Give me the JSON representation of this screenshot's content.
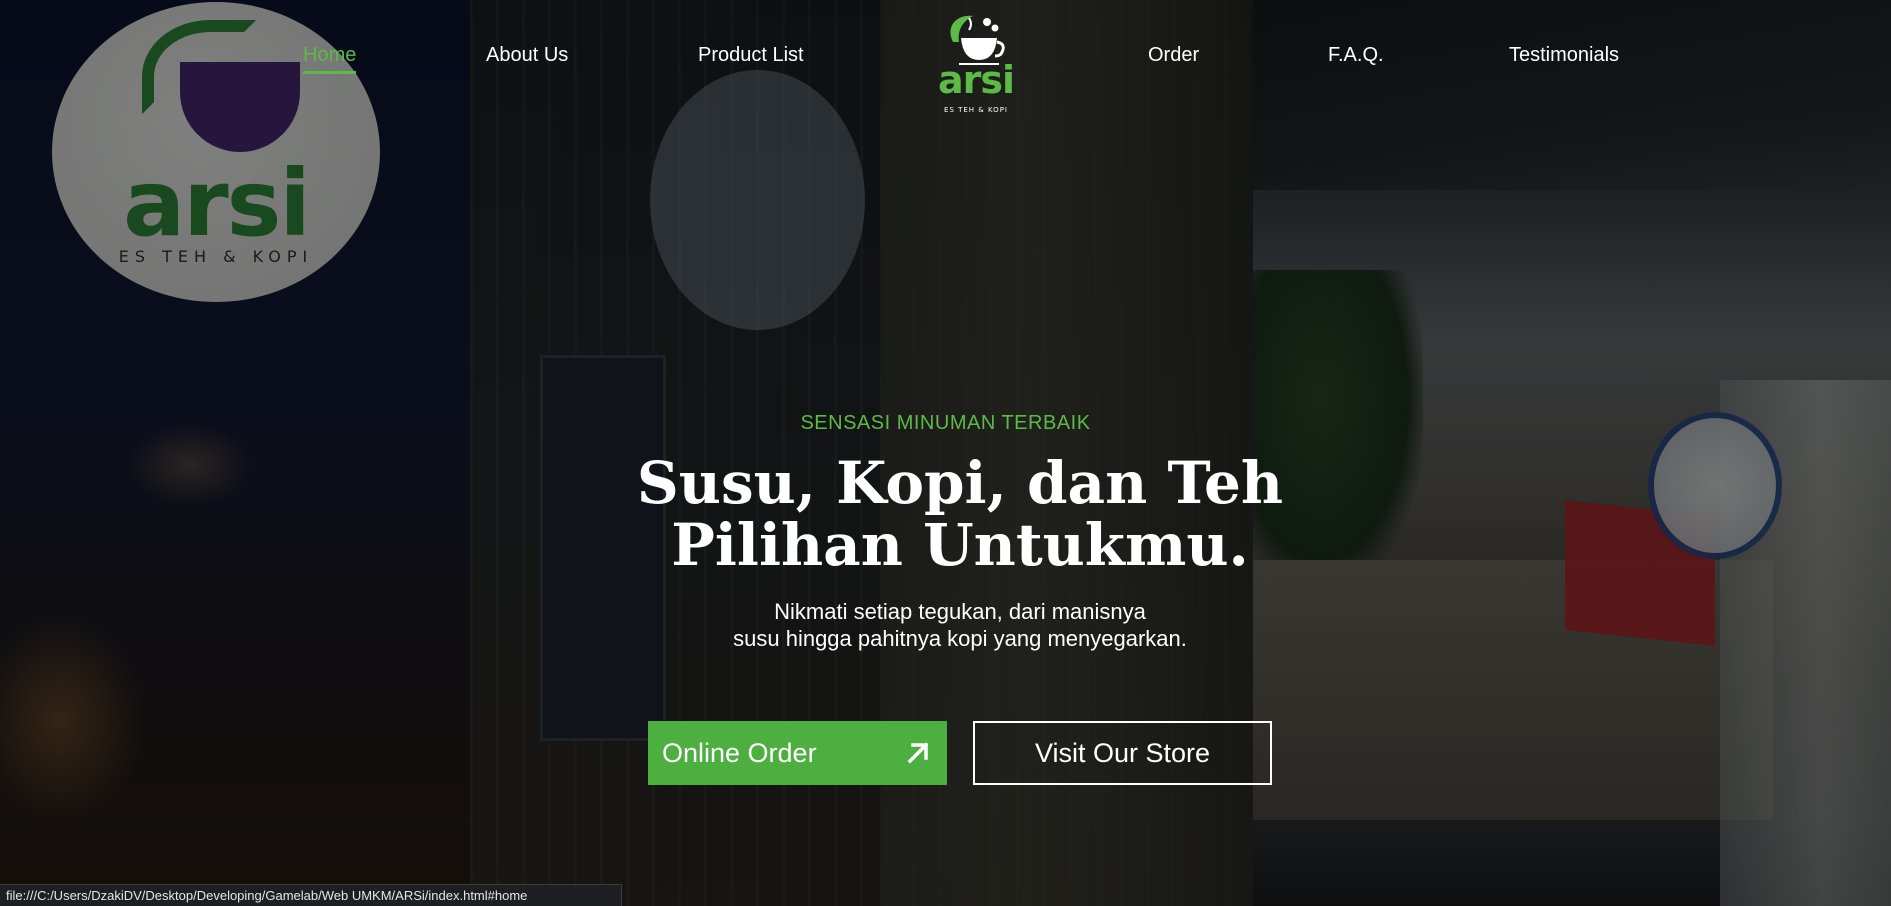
{
  "nav": {
    "links": [
      {
        "label": "Home",
        "active": true
      },
      {
        "label": "About Us",
        "active": false
      },
      {
        "label": "Product List",
        "active": false
      },
      {
        "label": "Order",
        "active": false
      },
      {
        "label": "F.A.Q.",
        "active": false
      },
      {
        "label": "Testimonials",
        "active": false
      }
    ],
    "logo": {
      "word": "arsi",
      "tagline": "ES TEH & KOPI"
    }
  },
  "hero": {
    "tagline": "SENSASI MINUMAN TERBAIK",
    "headline": [
      "Susu, Kopi, dan Teh",
      "Pilihan Untukmu."
    ],
    "subtext": [
      "Nikmati setiap tegukan, dari manisnya",
      "susu hingga pahitnya kopi yang menyegarkan."
    ],
    "buttons": {
      "order": {
        "label": "Online Order",
        "icon": "arrow-up-right-icon"
      },
      "visit": {
        "label": "Visit Our Store"
      }
    },
    "background": {
      "store_sign_word": "arsi",
      "store_sign_tag": "ES TEH & KOPI"
    }
  },
  "status_bar": {
    "url": "file:///C:/Users/DzakiDV/Desktop/Developing/Gamelab/Web UMKM/ARSi/index.html#home"
  },
  "colors": {
    "accent": "#5cba47",
    "button_fill": "#4caf3f",
    "text": "#ffffff",
    "overlay": "rgba(0,0,0,0.48)"
  }
}
